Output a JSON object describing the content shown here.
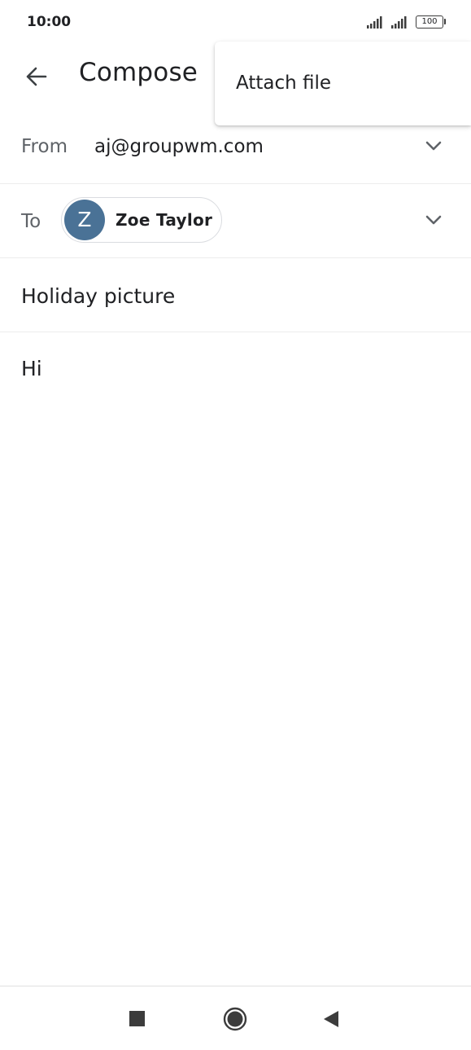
{
  "status_bar": {
    "time": "10:00",
    "battery": "100"
  },
  "header": {
    "title": "Compose",
    "back_icon": "arrow-left-icon"
  },
  "overflow_menu": {
    "items": [
      {
        "label": "Attach file"
      }
    ]
  },
  "from": {
    "label": "From",
    "value": "aj@groupwm.com"
  },
  "to": {
    "label": "To",
    "recipients": [
      {
        "initial": "Z",
        "name": "Zoe Taylor",
        "avatar_color": "#4a7296"
      }
    ]
  },
  "subject": {
    "value": "Holiday picture"
  },
  "body": {
    "value": "Hi"
  },
  "nav_bar": {
    "icons": [
      "square-recents-icon",
      "circle-home-icon",
      "triangle-back-icon"
    ]
  },
  "colors": {
    "text_primary": "#202124",
    "text_secondary": "#5f6368",
    "divider": "#ececec"
  }
}
